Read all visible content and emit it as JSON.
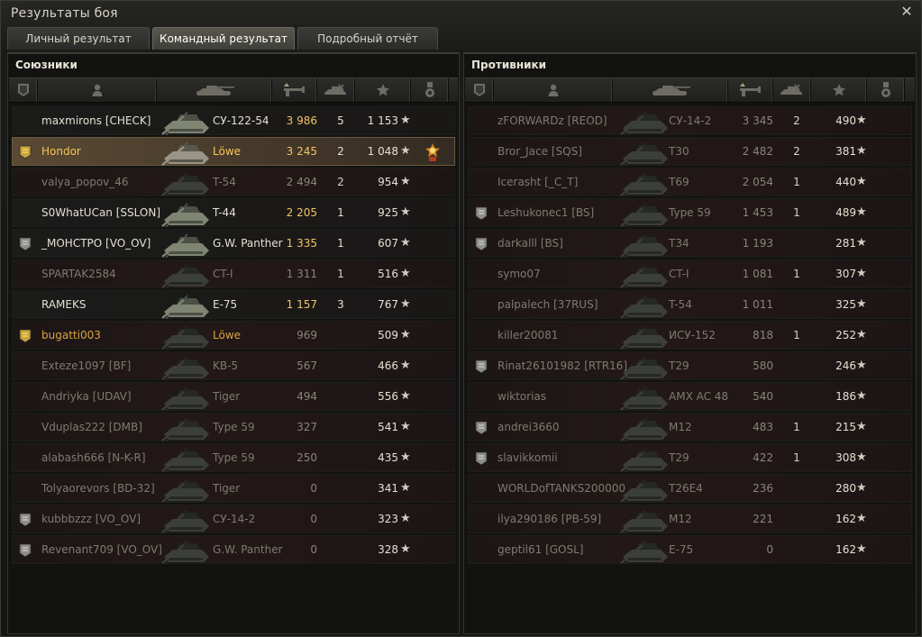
{
  "window": {
    "title": "Результаты боя",
    "close_symbol": "✕"
  },
  "tabs": [
    {
      "label": "Личный результат",
      "active": false
    },
    {
      "label": "Командный результат",
      "active": true
    },
    {
      "label": "Подробный отчёт",
      "active": false
    }
  ],
  "columns": [
    "rank-icon",
    "player-icon",
    "tank-icon",
    "damage-icon",
    "kills-icon",
    "xp-star-icon",
    "medal-icon"
  ],
  "star_glyph": "★",
  "allies": {
    "title": "Союзники",
    "rows": [
      {
        "player": "maxmirons [CHECK]",
        "tank": "СУ-122-54",
        "damage": "3 986",
        "kills": "5",
        "xp": "1 153",
        "state": "alive",
        "badge": "",
        "medal": false,
        "highlight": false
      },
      {
        "player": "Hondor",
        "tank": "Löwe",
        "damage": "3 245",
        "kills": "2",
        "xp": "1 048",
        "state": "alive",
        "badge": "gold",
        "medal": true,
        "highlight": true
      },
      {
        "player": "valya_popov_46",
        "tank": "T-54",
        "damage": "2 494",
        "kills": "2",
        "xp": "954",
        "state": "dead",
        "badge": "",
        "medal": false,
        "highlight": false
      },
      {
        "player": "S0WhatUCan [SSLON]",
        "tank": "T-44",
        "damage": "2 205",
        "kills": "1",
        "xp": "925",
        "state": "alive",
        "badge": "",
        "medal": false,
        "highlight": false
      },
      {
        "player": "_MOHCTPO [VO_OV]",
        "tank": "G.W. Panther",
        "damage": "1 335",
        "kills": "1",
        "xp": "607",
        "state": "alive",
        "badge": "silver",
        "medal": false,
        "highlight": false
      },
      {
        "player": "SPARTAK2584",
        "tank": "CT-I",
        "damage": "1 311",
        "kills": "1",
        "xp": "516",
        "state": "dead",
        "badge": "",
        "medal": false,
        "highlight": false
      },
      {
        "player": "RAMEKS",
        "tank": "E-75",
        "damage": "1 157",
        "kills": "3",
        "xp": "767",
        "state": "alive",
        "badge": "",
        "medal": false,
        "highlight": false
      },
      {
        "player": "bugatti003",
        "tank": "Löwe",
        "damage": "969",
        "kills": "",
        "xp": "509",
        "state": "dead",
        "badge": "gold",
        "medal": false,
        "highlight": false,
        "platoon": true
      },
      {
        "player": "Exteze1097 [BF]",
        "tank": "KB-5",
        "damage": "567",
        "kills": "",
        "xp": "466",
        "state": "dead",
        "badge": "",
        "medal": false,
        "highlight": false
      },
      {
        "player": "Andriyka [UDAV]",
        "tank": "Tiger",
        "damage": "494",
        "kills": "",
        "xp": "556",
        "state": "dead",
        "badge": "",
        "medal": false,
        "highlight": false
      },
      {
        "player": "Vduplas222 [DMB]",
        "tank": "Type 59",
        "damage": "327",
        "kills": "",
        "xp": "541",
        "state": "dead",
        "badge": "",
        "medal": false,
        "highlight": false
      },
      {
        "player": "alabash666 [N-K-R]",
        "tank": "Type 59",
        "damage": "250",
        "kills": "",
        "xp": "435",
        "state": "dead",
        "badge": "",
        "medal": false,
        "highlight": false
      },
      {
        "player": "Tolyaorevors [BD-32]",
        "tank": "Tiger",
        "damage": "0",
        "kills": "",
        "xp": "341",
        "state": "dead",
        "badge": "",
        "medal": false,
        "highlight": false
      },
      {
        "player": "kubbbzzz [VO_OV]",
        "tank": "СУ-14-2",
        "damage": "0",
        "kills": "",
        "xp": "323",
        "state": "dead",
        "badge": "silver",
        "medal": false,
        "highlight": false
      },
      {
        "player": "Revenant709 [VO_OV]",
        "tank": "G.W. Panther",
        "damage": "0",
        "kills": "",
        "xp": "328",
        "state": "dead",
        "badge": "silver",
        "medal": false,
        "highlight": false
      }
    ]
  },
  "enemies": {
    "title": "Противники",
    "rows": [
      {
        "player": "zFORWARDz [REOD]",
        "tank": "СУ-14-2",
        "damage": "3 345",
        "kills": "2",
        "xp": "490",
        "state": "dead",
        "badge": "",
        "medal": false,
        "highlight": false
      },
      {
        "player": "Bror_Jace [SQS]",
        "tank": "T30",
        "damage": "2 482",
        "kills": "2",
        "xp": "381",
        "state": "dead",
        "badge": "",
        "medal": false,
        "highlight": false
      },
      {
        "player": "Icerasht [_C_T]",
        "tank": "T69",
        "damage": "2 054",
        "kills": "1",
        "xp": "440",
        "state": "dead",
        "badge": "",
        "medal": false,
        "highlight": false
      },
      {
        "player": "Leshukonec1 [BS]",
        "tank": "Type 59",
        "damage": "1 453",
        "kills": "1",
        "xp": "489",
        "state": "dead",
        "badge": "silver",
        "medal": false,
        "highlight": false
      },
      {
        "player": "darkalll [BS]",
        "tank": "T34",
        "damage": "1 193",
        "kills": "",
        "xp": "281",
        "state": "dead",
        "badge": "silver",
        "medal": false,
        "highlight": false
      },
      {
        "player": "symo07",
        "tank": "CT-I",
        "damage": "1 081",
        "kills": "1",
        "xp": "307",
        "state": "dead",
        "badge": "",
        "medal": false,
        "highlight": false
      },
      {
        "player": "palpalech [37RUS]",
        "tank": "T-54",
        "damage": "1 011",
        "kills": "",
        "xp": "325",
        "state": "dead",
        "badge": "",
        "medal": false,
        "highlight": false
      },
      {
        "player": "killer20081",
        "tank": "ИСУ-152",
        "damage": "818",
        "kills": "1",
        "xp": "252",
        "state": "dead",
        "badge": "",
        "medal": false,
        "highlight": false
      },
      {
        "player": "Rinat26101982 [RTR16]",
        "tank": "T29",
        "damage": "580",
        "kills": "",
        "xp": "246",
        "state": "dead",
        "badge": "silver",
        "medal": false,
        "highlight": false
      },
      {
        "player": "wiktorias",
        "tank": "AMX AC 48",
        "damage": "540",
        "kills": "",
        "xp": "186",
        "state": "dead",
        "badge": "",
        "medal": false,
        "highlight": false
      },
      {
        "player": "andrei3660",
        "tank": "M12",
        "damage": "483",
        "kills": "1",
        "xp": "215",
        "state": "dead",
        "badge": "silver",
        "medal": false,
        "highlight": false
      },
      {
        "player": "slavikkomii",
        "tank": "T29",
        "damage": "422",
        "kills": "1",
        "xp": "308",
        "state": "dead",
        "badge": "silver",
        "medal": false,
        "highlight": false
      },
      {
        "player": "WORLDofTANKS200000",
        "tank": "T26E4",
        "damage": "236",
        "kills": "",
        "xp": "280",
        "state": "dead",
        "badge": "",
        "medal": false,
        "highlight": false
      },
      {
        "player": "ilya290186 [PB-59]",
        "tank": "M12",
        "damage": "221",
        "kills": "",
        "xp": "162",
        "state": "dead",
        "badge": "",
        "medal": false,
        "highlight": false
      },
      {
        "player": "geptil61 [GOSL]",
        "tank": "E-75",
        "damage": "0",
        "kills": "",
        "xp": "162",
        "state": "dead",
        "badge": "",
        "medal": false,
        "highlight": false
      }
    ]
  }
}
